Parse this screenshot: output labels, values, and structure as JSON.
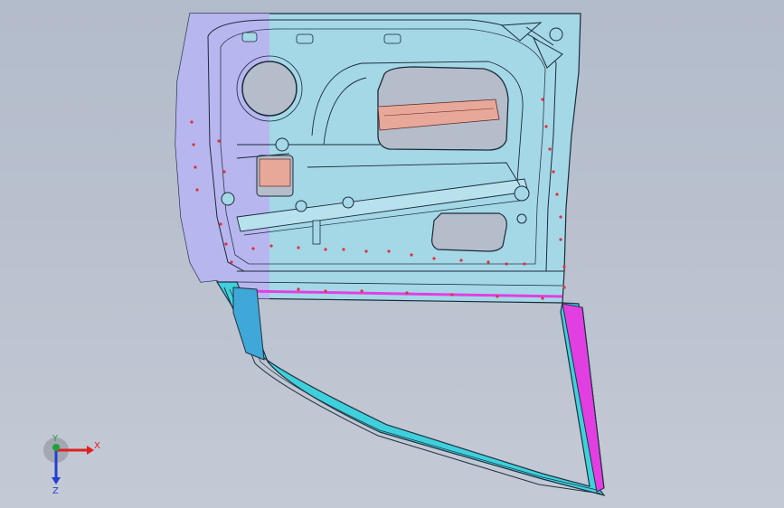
{
  "viewport": {
    "background_top": "#b3bccb",
    "background_bottom": "#c4cad5"
  },
  "model": {
    "part": "door-inner-panel",
    "colors": {
      "panel_fill": "#a5d8e6",
      "panel_stroke": "#1a2a3a",
      "hinge_side": "#b7b4ef",
      "frame_cyan": "#3fd0dc",
      "frame_dark": "#203040",
      "reinforcement": "#e7a89a",
      "magenta_strip": "#e23fe3",
      "weld_point": "#e0303a"
    }
  },
  "triad": {
    "x_label": "X",
    "y_label": "Y",
    "z_label": "Z",
    "colors": {
      "x": "#e02020",
      "y": "#20a040",
      "z": "#2040d0"
    }
  }
}
